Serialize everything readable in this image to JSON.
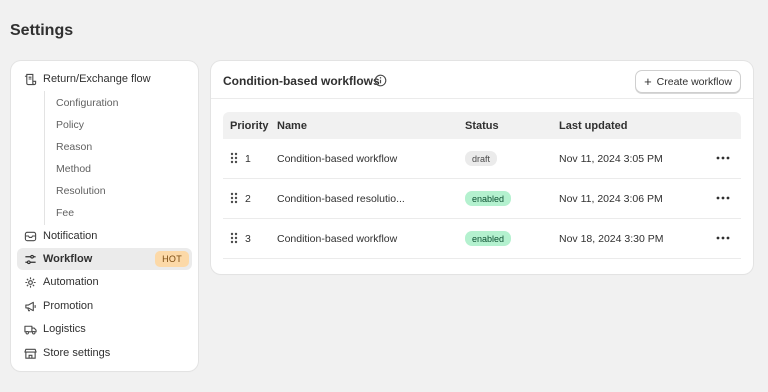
{
  "page": {
    "title": "Settings"
  },
  "sidebar": {
    "return_exchange": {
      "label": "Return/Exchange flow",
      "sub_items": [
        "Configuration",
        "Policy",
        "Reason",
        "Method",
        "Resolution",
        "Fee"
      ]
    },
    "items": [
      {
        "label": "Notification",
        "icon": "mail-icon"
      },
      {
        "label": "Workflow",
        "icon": "workflow-icon",
        "active": true,
        "badge": "HOT"
      },
      {
        "label": "Automation",
        "icon": "automation-gear-icon"
      },
      {
        "label": "Promotion",
        "icon": "megaphone-icon"
      },
      {
        "label": "Logistics",
        "icon": "truck-icon"
      },
      {
        "label": "Store settings",
        "icon": "store-icon"
      }
    ]
  },
  "main": {
    "title": "Condition-based workflows",
    "create_button": "Create workflow",
    "columns": [
      "Priority",
      "Name",
      "Status",
      "Last updated"
    ],
    "rows": [
      {
        "priority": "1",
        "name": "Condition-based workflow",
        "status": "draft",
        "updated": "Nov 11, 2024 3:05 PM"
      },
      {
        "priority": "2",
        "name": "Condition-based resolutio...",
        "status": "enabled",
        "updated": "Nov 11, 2024 3:06 PM"
      },
      {
        "priority": "3",
        "name": "Condition-based workflow",
        "status": "enabled",
        "updated": "Nov 18, 2024 3:30 PM"
      }
    ]
  },
  "colors": {
    "active_bg": "#ebebeb",
    "hot_badge_bg": "#fcd9a8",
    "enabled_bg": "#b4f1cf",
    "draft_bg": "#ebebeb"
  }
}
